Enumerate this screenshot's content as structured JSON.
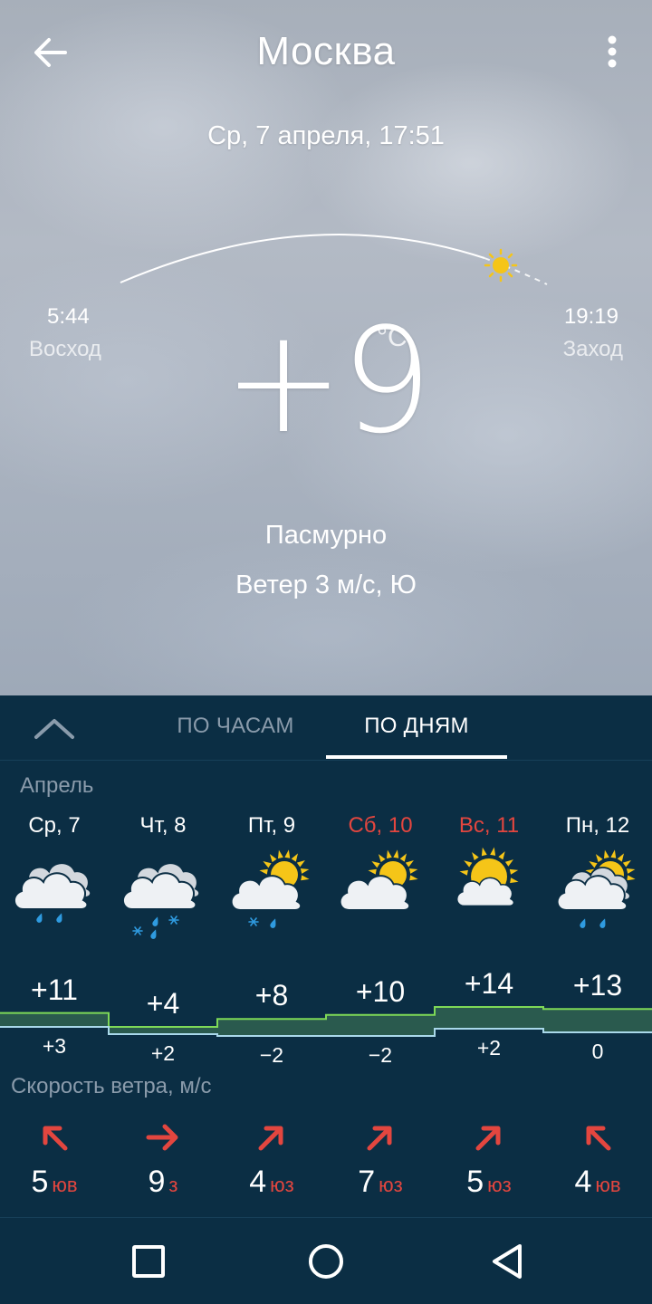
{
  "header": {
    "city": "Москва",
    "date_time": "Ср, 7 апреля, 17:51"
  },
  "sun": {
    "sunrise_time": "5:44",
    "sunrise_label": "Восход",
    "sunset_time": "19:19",
    "sunset_label": "Заход"
  },
  "current": {
    "temperature": "+9",
    "unit": "°C",
    "condition": "Пасмурно",
    "wind": "Ветер 3 м/с, Ю"
  },
  "tabs": {
    "hourly": "ПО ЧАСАМ",
    "daily": "ПО ДНЯМ",
    "active": "daily"
  },
  "forecast": {
    "month": "Апрель",
    "days": [
      {
        "label": "Ср, 7",
        "weekend": false,
        "icon": "cloud-rain-icon",
        "tmax": "+11",
        "tmin": "+3",
        "wind_speed": "5",
        "wind_dir": "юв",
        "wind_arrow": "arrow-up-left-icon"
      },
      {
        "label": "Чт, 8",
        "weekend": false,
        "icon": "cloud-sleet-icon",
        "tmax": "+4",
        "tmin": "+2",
        "wind_speed": "9",
        "wind_dir": "з",
        "wind_arrow": "arrow-right-icon"
      },
      {
        "label": "Пт, 9",
        "weekend": false,
        "icon": "partly-cloudy-sleet-icon",
        "tmax": "+8",
        "tmin": "−2",
        "wind_speed": "4",
        "wind_dir": "юз",
        "wind_arrow": "arrow-up-right-icon"
      },
      {
        "label": "Сб, 10",
        "weekend": true,
        "icon": "partly-cloudy-icon",
        "tmax": "+10",
        "tmin": "−2",
        "wind_speed": "7",
        "wind_dir": "юз",
        "wind_arrow": "arrow-up-right-icon"
      },
      {
        "label": "Вс, 11",
        "weekend": true,
        "icon": "mostly-sunny-icon",
        "tmax": "+14",
        "tmin": "+2",
        "wind_speed": "5",
        "wind_dir": "юз",
        "wind_arrow": "arrow-up-right-icon"
      },
      {
        "label": "Пн, 12",
        "weekend": false,
        "icon": "partly-cloudy-rain-icon",
        "tmax": "+13",
        "tmin": "0",
        "wind_speed": "4",
        "wind_dir": "юв",
        "wind_arrow": "arrow-up-left-icon"
      }
    ],
    "wind_title": "Скорость ветра, м/с"
  },
  "colors": {
    "panel_bg": "#0b2e44",
    "weekend_red": "#e3463f",
    "max_line_green": "#7ed957",
    "min_line_blue": "#a9d8ea",
    "strip_fill": "#2a5a4e",
    "sun_yellow": "#f5c518",
    "rain_blue": "#2f9be0"
  },
  "navbar": {
    "icons": [
      "recent-apps-icon",
      "home-icon",
      "back-nav-icon"
    ]
  }
}
